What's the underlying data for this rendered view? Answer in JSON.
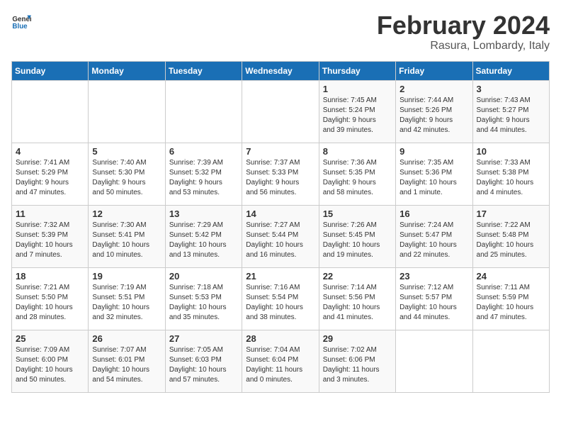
{
  "header": {
    "logo_general": "General",
    "logo_blue": "Blue",
    "month_title": "February 2024",
    "location": "Rasura, Lombardy, Italy"
  },
  "weekdays": [
    "Sunday",
    "Monday",
    "Tuesday",
    "Wednesday",
    "Thursday",
    "Friday",
    "Saturday"
  ],
  "weeks": [
    [
      {
        "day": "",
        "info": ""
      },
      {
        "day": "",
        "info": ""
      },
      {
        "day": "",
        "info": ""
      },
      {
        "day": "",
        "info": ""
      },
      {
        "day": "1",
        "info": "Sunrise: 7:45 AM\nSunset: 5:24 PM\nDaylight: 9 hours\nand 39 minutes."
      },
      {
        "day": "2",
        "info": "Sunrise: 7:44 AM\nSunset: 5:26 PM\nDaylight: 9 hours\nand 42 minutes."
      },
      {
        "day": "3",
        "info": "Sunrise: 7:43 AM\nSunset: 5:27 PM\nDaylight: 9 hours\nand 44 minutes."
      }
    ],
    [
      {
        "day": "4",
        "info": "Sunrise: 7:41 AM\nSunset: 5:29 PM\nDaylight: 9 hours\nand 47 minutes."
      },
      {
        "day": "5",
        "info": "Sunrise: 7:40 AM\nSunset: 5:30 PM\nDaylight: 9 hours\nand 50 minutes."
      },
      {
        "day": "6",
        "info": "Sunrise: 7:39 AM\nSunset: 5:32 PM\nDaylight: 9 hours\nand 53 minutes."
      },
      {
        "day": "7",
        "info": "Sunrise: 7:37 AM\nSunset: 5:33 PM\nDaylight: 9 hours\nand 56 minutes."
      },
      {
        "day": "8",
        "info": "Sunrise: 7:36 AM\nSunset: 5:35 PM\nDaylight: 9 hours\nand 58 minutes."
      },
      {
        "day": "9",
        "info": "Sunrise: 7:35 AM\nSunset: 5:36 PM\nDaylight: 10 hours\nand 1 minute."
      },
      {
        "day": "10",
        "info": "Sunrise: 7:33 AM\nSunset: 5:38 PM\nDaylight: 10 hours\nand 4 minutes."
      }
    ],
    [
      {
        "day": "11",
        "info": "Sunrise: 7:32 AM\nSunset: 5:39 PM\nDaylight: 10 hours\nand 7 minutes."
      },
      {
        "day": "12",
        "info": "Sunrise: 7:30 AM\nSunset: 5:41 PM\nDaylight: 10 hours\nand 10 minutes."
      },
      {
        "day": "13",
        "info": "Sunrise: 7:29 AM\nSunset: 5:42 PM\nDaylight: 10 hours\nand 13 minutes."
      },
      {
        "day": "14",
        "info": "Sunrise: 7:27 AM\nSunset: 5:44 PM\nDaylight: 10 hours\nand 16 minutes."
      },
      {
        "day": "15",
        "info": "Sunrise: 7:26 AM\nSunset: 5:45 PM\nDaylight: 10 hours\nand 19 minutes."
      },
      {
        "day": "16",
        "info": "Sunrise: 7:24 AM\nSunset: 5:47 PM\nDaylight: 10 hours\nand 22 minutes."
      },
      {
        "day": "17",
        "info": "Sunrise: 7:22 AM\nSunset: 5:48 PM\nDaylight: 10 hours\nand 25 minutes."
      }
    ],
    [
      {
        "day": "18",
        "info": "Sunrise: 7:21 AM\nSunset: 5:50 PM\nDaylight: 10 hours\nand 28 minutes."
      },
      {
        "day": "19",
        "info": "Sunrise: 7:19 AM\nSunset: 5:51 PM\nDaylight: 10 hours\nand 32 minutes."
      },
      {
        "day": "20",
        "info": "Sunrise: 7:18 AM\nSunset: 5:53 PM\nDaylight: 10 hours\nand 35 minutes."
      },
      {
        "day": "21",
        "info": "Sunrise: 7:16 AM\nSunset: 5:54 PM\nDaylight: 10 hours\nand 38 minutes."
      },
      {
        "day": "22",
        "info": "Sunrise: 7:14 AM\nSunset: 5:56 PM\nDaylight: 10 hours\nand 41 minutes."
      },
      {
        "day": "23",
        "info": "Sunrise: 7:12 AM\nSunset: 5:57 PM\nDaylight: 10 hours\nand 44 minutes."
      },
      {
        "day": "24",
        "info": "Sunrise: 7:11 AM\nSunset: 5:59 PM\nDaylight: 10 hours\nand 47 minutes."
      }
    ],
    [
      {
        "day": "25",
        "info": "Sunrise: 7:09 AM\nSunset: 6:00 PM\nDaylight: 10 hours\nand 50 minutes."
      },
      {
        "day": "26",
        "info": "Sunrise: 7:07 AM\nSunset: 6:01 PM\nDaylight: 10 hours\nand 54 minutes."
      },
      {
        "day": "27",
        "info": "Sunrise: 7:05 AM\nSunset: 6:03 PM\nDaylight: 10 hours\nand 57 minutes."
      },
      {
        "day": "28",
        "info": "Sunrise: 7:04 AM\nSunset: 6:04 PM\nDaylight: 11 hours\nand 0 minutes."
      },
      {
        "day": "29",
        "info": "Sunrise: 7:02 AM\nSunset: 6:06 PM\nDaylight: 11 hours\nand 3 minutes."
      },
      {
        "day": "",
        "info": ""
      },
      {
        "day": "",
        "info": ""
      }
    ]
  ]
}
